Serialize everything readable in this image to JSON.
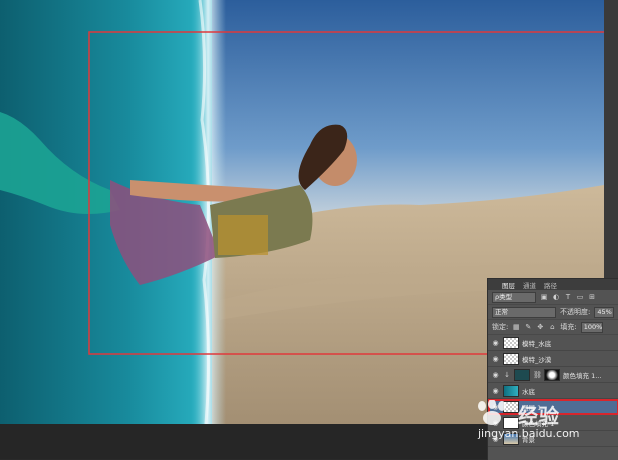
{
  "layers_panel": {
    "tabs": [
      "图层",
      "通道",
      "路径"
    ],
    "filter_kind": "ρ类型",
    "blend_mode": "正常",
    "opacity_label": "不透明度:",
    "opacity_value": "45%",
    "lock_label": "锁定:",
    "fill_label": "填充:",
    "fill_value": "100%",
    "layers": [
      {
        "name": "模特_水底",
        "selected": false
      },
      {
        "name": "模特_沙漠",
        "selected": false
      },
      {
        "name": "颜色填充 1...",
        "selected": false
      },
      {
        "name": "水底",
        "selected": false
      },
      {
        "name": "图层 1",
        "selected": true
      },
      {
        "name": "颜色填充 1",
        "selected": false
      },
      {
        "name": "背景",
        "selected": false
      }
    ]
  },
  "watermark": {
    "brand": "经验",
    "url": "jingyan.baidu.com"
  },
  "colors": {
    "selection_box": "#e0393c",
    "highlight_box": "#d8262c",
    "selected_layer": "#4f6d95"
  }
}
